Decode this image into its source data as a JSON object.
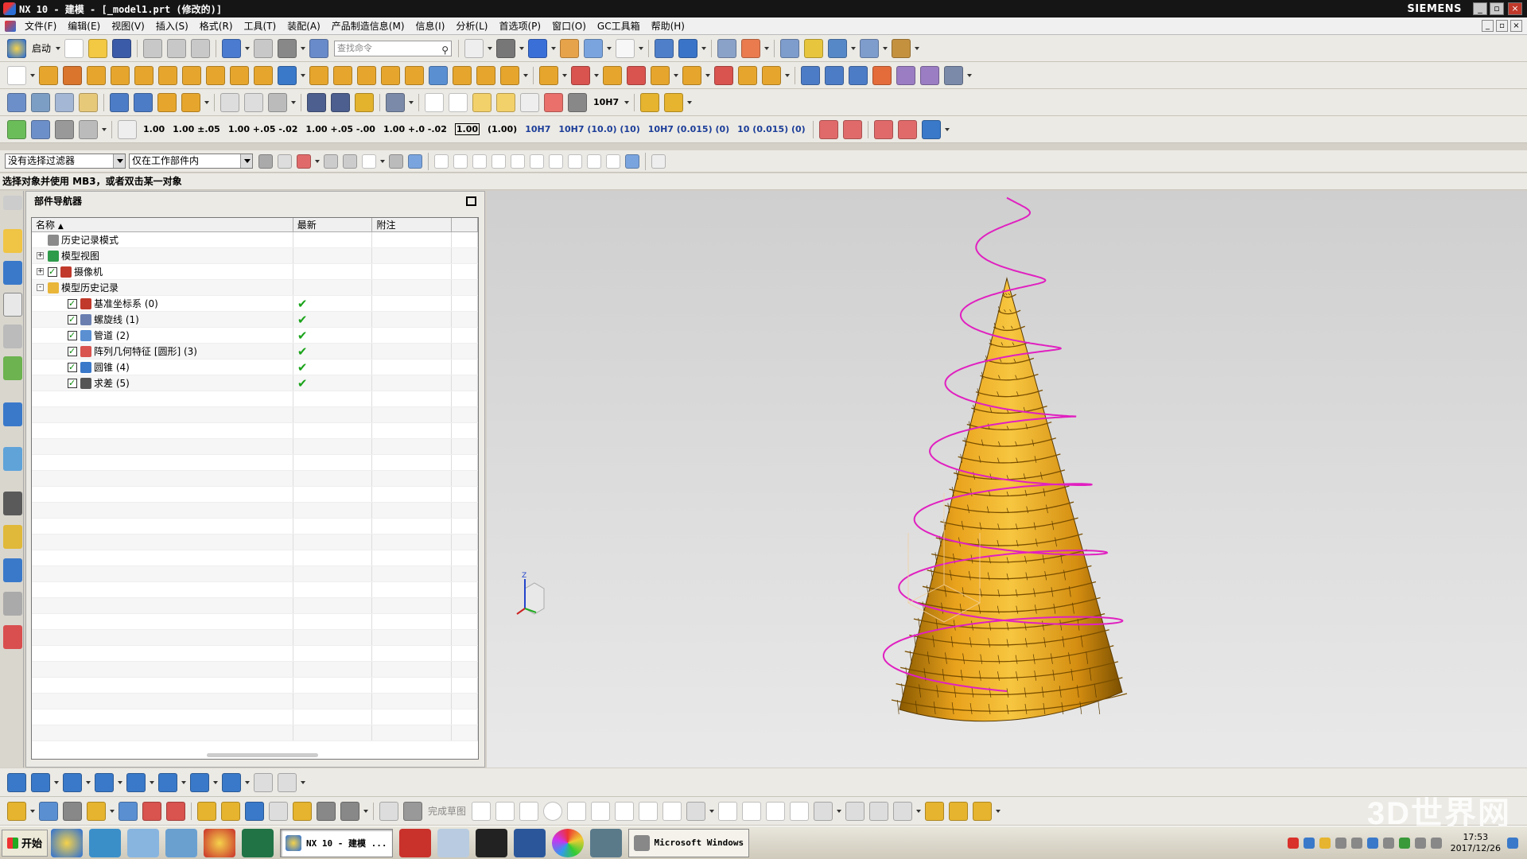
{
  "window": {
    "title": "NX 10 - 建模 - [_model1.prt (修改的)]",
    "brand": "SIEMENS"
  },
  "menu": {
    "items": [
      "文件(F)",
      "编辑(E)",
      "视图(V)",
      "插入(S)",
      "格式(R)",
      "工具(T)",
      "装配(A)",
      "产品制造信息(M)",
      "信息(I)",
      "分析(L)",
      "首选项(P)",
      "窗口(O)",
      "GC工具箱",
      "帮助(H)"
    ]
  },
  "toolbar1": {
    "start_label": "启动",
    "search_placeholder": "查找命令"
  },
  "toolbar4": {
    "dim_labels": [
      "1.00",
      "1.00 ±.05",
      "1.00 +.05 -.02",
      "1.00 +.05 -.00",
      "1.00 +.0 -.02",
      "1.00",
      "(1.00)",
      "10H7",
      "10H7 (10.0) (10)",
      "10H7 (0.015) (0)",
      "10 (0.015) (0)"
    ],
    "h7_label": "10H7"
  },
  "filterbar": {
    "type_filter": "没有选择过滤器",
    "scope_filter": "仅在工作部件内"
  },
  "cueline": {
    "text": "选择对象并使用 MB3，或者双击某一对象"
  },
  "navigator": {
    "title": "部件导航器",
    "columns": [
      "名称",
      "最新",
      "附注"
    ],
    "rows": [
      {
        "label": "历史记录模式",
        "indent": 0,
        "expander": "",
        "check": false,
        "icon": "clock-icon",
        "latest": false
      },
      {
        "label": "模型视图",
        "indent": 0,
        "expander": "+",
        "check": false,
        "icon": "views-icon",
        "latest": false
      },
      {
        "label": "摄像机",
        "indent": 0,
        "expander": "+",
        "check": true,
        "icon": "camera-icon",
        "latest": false
      },
      {
        "label": "模型历史记录",
        "indent": 0,
        "expander": "-",
        "check": false,
        "icon": "folder-icon",
        "latest": false
      },
      {
        "label": "基准坐标系 (0)",
        "indent": 1,
        "expander": "",
        "check": true,
        "icon": "datum-csys-icon",
        "latest": true
      },
      {
        "label": "螺旋线 (1)",
        "indent": 1,
        "expander": "",
        "check": true,
        "icon": "helix-icon",
        "latest": true
      },
      {
        "label": "管道 (2)",
        "indent": 1,
        "expander": "",
        "check": true,
        "icon": "tube-icon",
        "latest": true
      },
      {
        "label": "阵列几何特征 [圆形] (3)",
        "indent": 1,
        "expander": "",
        "check": true,
        "icon": "pattern-icon",
        "latest": true
      },
      {
        "label": "圆锥 (4)",
        "indent": 1,
        "expander": "",
        "check": true,
        "icon": "cone-icon",
        "latest": true
      },
      {
        "label": "求差 (5)",
        "indent": 1,
        "expander": "",
        "check": true,
        "icon": "subtract-icon",
        "latest": true
      }
    ]
  },
  "bottom_toolbar": {
    "finish_sketch_label": "完成草图"
  },
  "taskbar": {
    "start_label": "开始",
    "active_window": "NX 10 - 建模 ...",
    "other_window": "Microsoft Windows",
    "clock_time": "17:53",
    "clock_date": "2017/12/26"
  },
  "watermark": "3D世界网",
  "colors": {
    "model": "#f0b020",
    "helix": "#e020c0",
    "check": "#1aa31a"
  }
}
